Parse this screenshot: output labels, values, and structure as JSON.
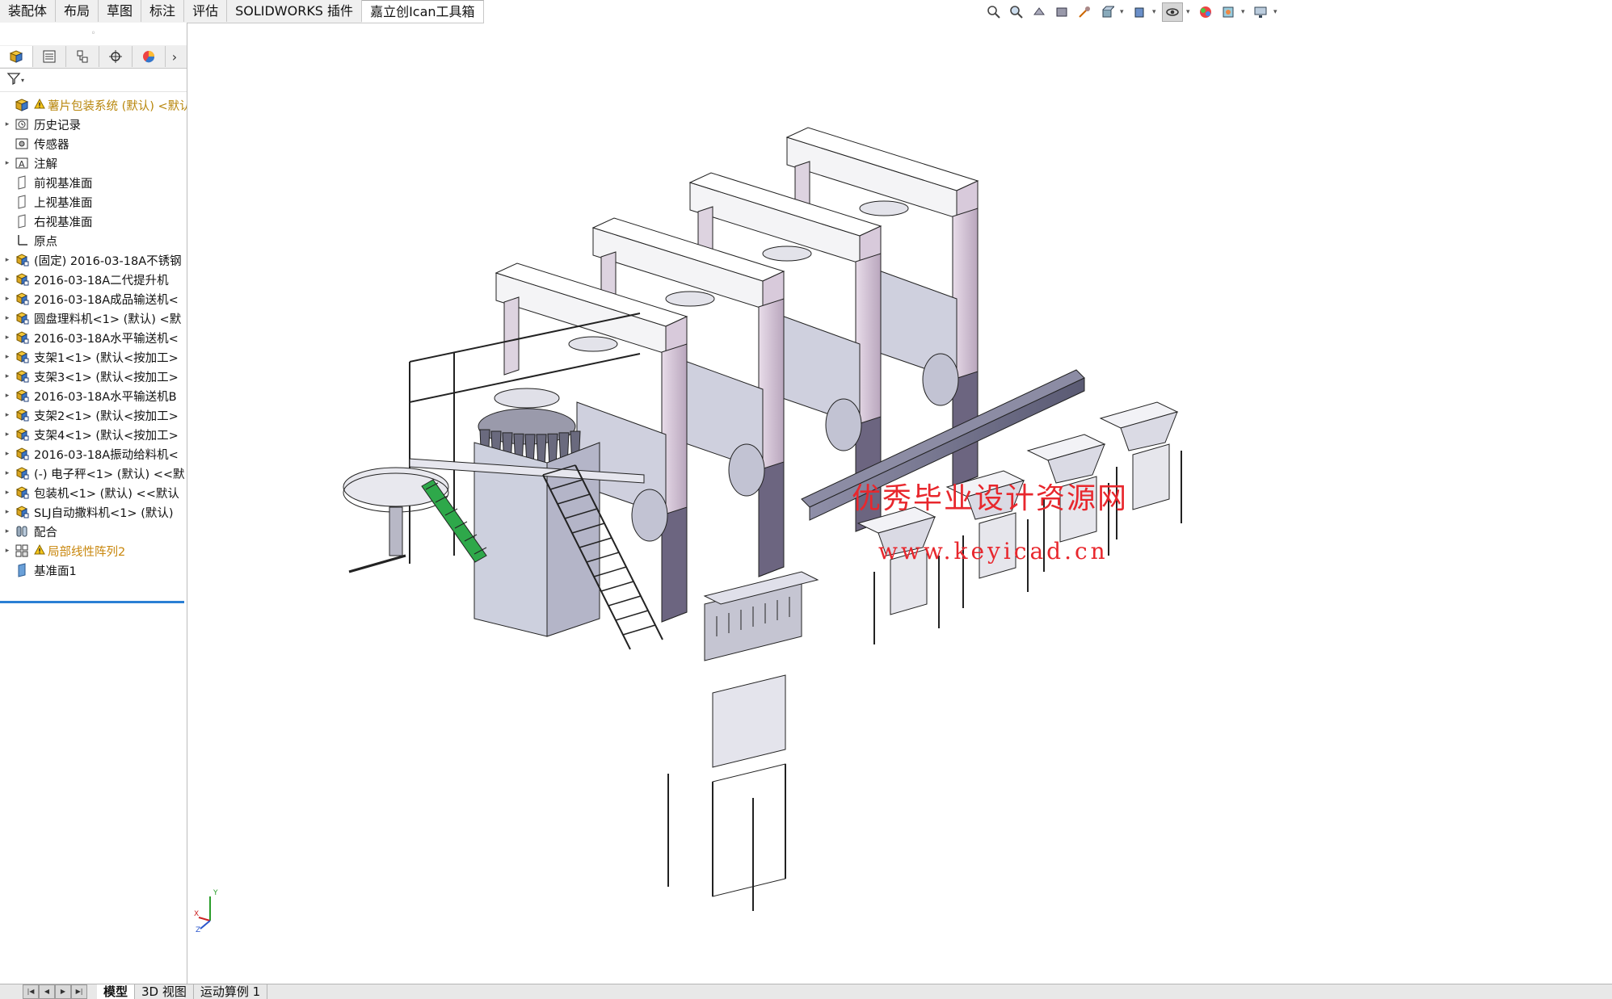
{
  "command_tabs": [
    "装配体",
    "布局",
    "草图",
    "标注",
    "评估",
    "SOLIDWORKS 插件",
    "嘉立创Ican工具箱"
  ],
  "panel": {
    "grip": "◦",
    "more": "›",
    "tabs": [
      "assembly-icon",
      "property-manager-icon",
      "configuration-manager-icon",
      "dimxpert-icon",
      "display-manager-icon"
    ]
  },
  "tree": [
    {
      "label": "薯片包装系统 (默认) <默认",
      "icon": "assembly-icon",
      "expand": "",
      "style": "root",
      "warn": true
    },
    {
      "label": "历史记录",
      "icon": "history-icon",
      "expand": "▸"
    },
    {
      "label": "传感器",
      "icon": "sensor-icon",
      "expand": ""
    },
    {
      "label": "注解",
      "icon": "annotation-icon",
      "expand": "▸"
    },
    {
      "label": "前视基准面",
      "icon": "plane-icon",
      "expand": ""
    },
    {
      "label": "上视基准面",
      "icon": "plane-icon",
      "expand": ""
    },
    {
      "label": "右视基准面",
      "icon": "plane-icon",
      "expand": ""
    },
    {
      "label": "原点",
      "icon": "origin-icon",
      "expand": ""
    },
    {
      "label": "(固定) 2016-03-18A不锈钢",
      "icon": "subassembly-icon",
      "expand": "▸"
    },
    {
      "label": "2016-03-18A二代提升机",
      "icon": "subassembly-icon",
      "expand": "▸"
    },
    {
      "label": "2016-03-18A成品输送机<",
      "icon": "subassembly-icon",
      "expand": "▸"
    },
    {
      "label": "圆盘理料机<1> (默认) <默",
      "icon": "subassembly-icon",
      "expand": "▸"
    },
    {
      "label": "2016-03-18A水平输送机<",
      "icon": "subassembly-icon",
      "expand": "▸"
    },
    {
      "label": "支架1<1> (默认<按加工>",
      "icon": "subassembly-icon",
      "expand": "▸"
    },
    {
      "label": "支架3<1> (默认<按加工>",
      "icon": "subassembly-icon",
      "expand": "▸"
    },
    {
      "label": "2016-03-18A水平输送机B",
      "icon": "subassembly-icon",
      "expand": "▸"
    },
    {
      "label": "支架2<1> (默认<按加工>",
      "icon": "subassembly-icon",
      "expand": "▸"
    },
    {
      "label": "支架4<1> (默认<按加工>",
      "icon": "subassembly-icon",
      "expand": "▸"
    },
    {
      "label": "2016-03-18A振动给料机<",
      "icon": "subassembly-icon",
      "expand": "▸"
    },
    {
      "label": "(-) 电子秤<1> (默认) <<默",
      "icon": "subassembly-icon",
      "expand": "▸"
    },
    {
      "label": "包装机<1> (默认) <<默认",
      "icon": "subassembly-icon",
      "expand": "▸"
    },
    {
      "label": "SLJ自动撒料机<1> (默认)",
      "icon": "subassembly-icon",
      "expand": "▸"
    },
    {
      "label": "配合",
      "icon": "mates-icon",
      "expand": "▸"
    },
    {
      "label": "局部线性阵列2",
      "icon": "pattern-icon",
      "expand": "▸",
      "style": "warn-orange",
      "warn": true
    },
    {
      "label": "基准面1",
      "icon": "plane-solid-icon",
      "expand": ""
    }
  ],
  "bottom_tabs": [
    "模型",
    "3D 视图",
    "运动算例 1"
  ],
  "nav_buttons": [
    "|◀",
    "◀",
    "▶",
    "▶|"
  ],
  "viewport": {
    "watermark_title": "优秀毕业设计资源网",
    "watermark_url": "www.keyicad.cn",
    "triad": {
      "y": "Y",
      "x": "X",
      "z": "Z"
    }
  },
  "colors": {
    "accent_blue": "#2a7fd4",
    "watermark_red": "#e8272d",
    "frame_lilac": "#d9c9dc",
    "machine_grey": "#c9cad6"
  }
}
